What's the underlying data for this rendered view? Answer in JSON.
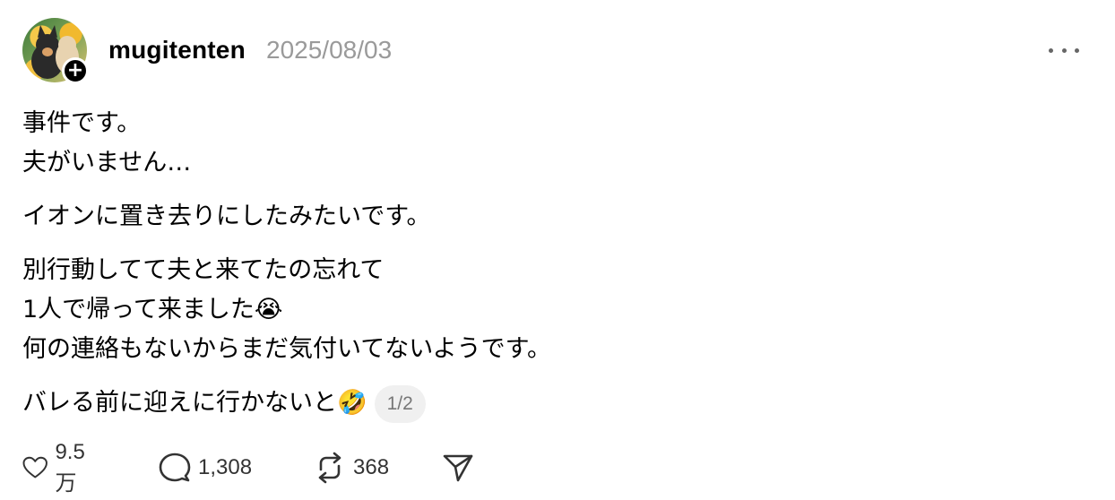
{
  "post": {
    "username": "mugitenten",
    "timestamp": "2025/08/03",
    "paragraphs": [
      [
        "事件です。",
        "夫がいません…"
      ],
      [
        "イオンに置き去りにしたみたいです。"
      ],
      [
        "別行動してて夫と来てたの忘れて",
        "1人で帰って来ました😭",
        "何の連絡もないからまだ気付いてないようです。"
      ],
      [
        "バレる前に迎えに行かないと🤣"
      ]
    ],
    "page_indicator": "1/2"
  },
  "actions": {
    "likes": "9.5万",
    "replies": "1,308",
    "reposts": "368"
  },
  "icons": {
    "follow": "plus-icon",
    "more": "more-icon",
    "like": "heart-icon",
    "reply": "comment-icon",
    "repost": "repost-icon",
    "share": "send-icon"
  }
}
